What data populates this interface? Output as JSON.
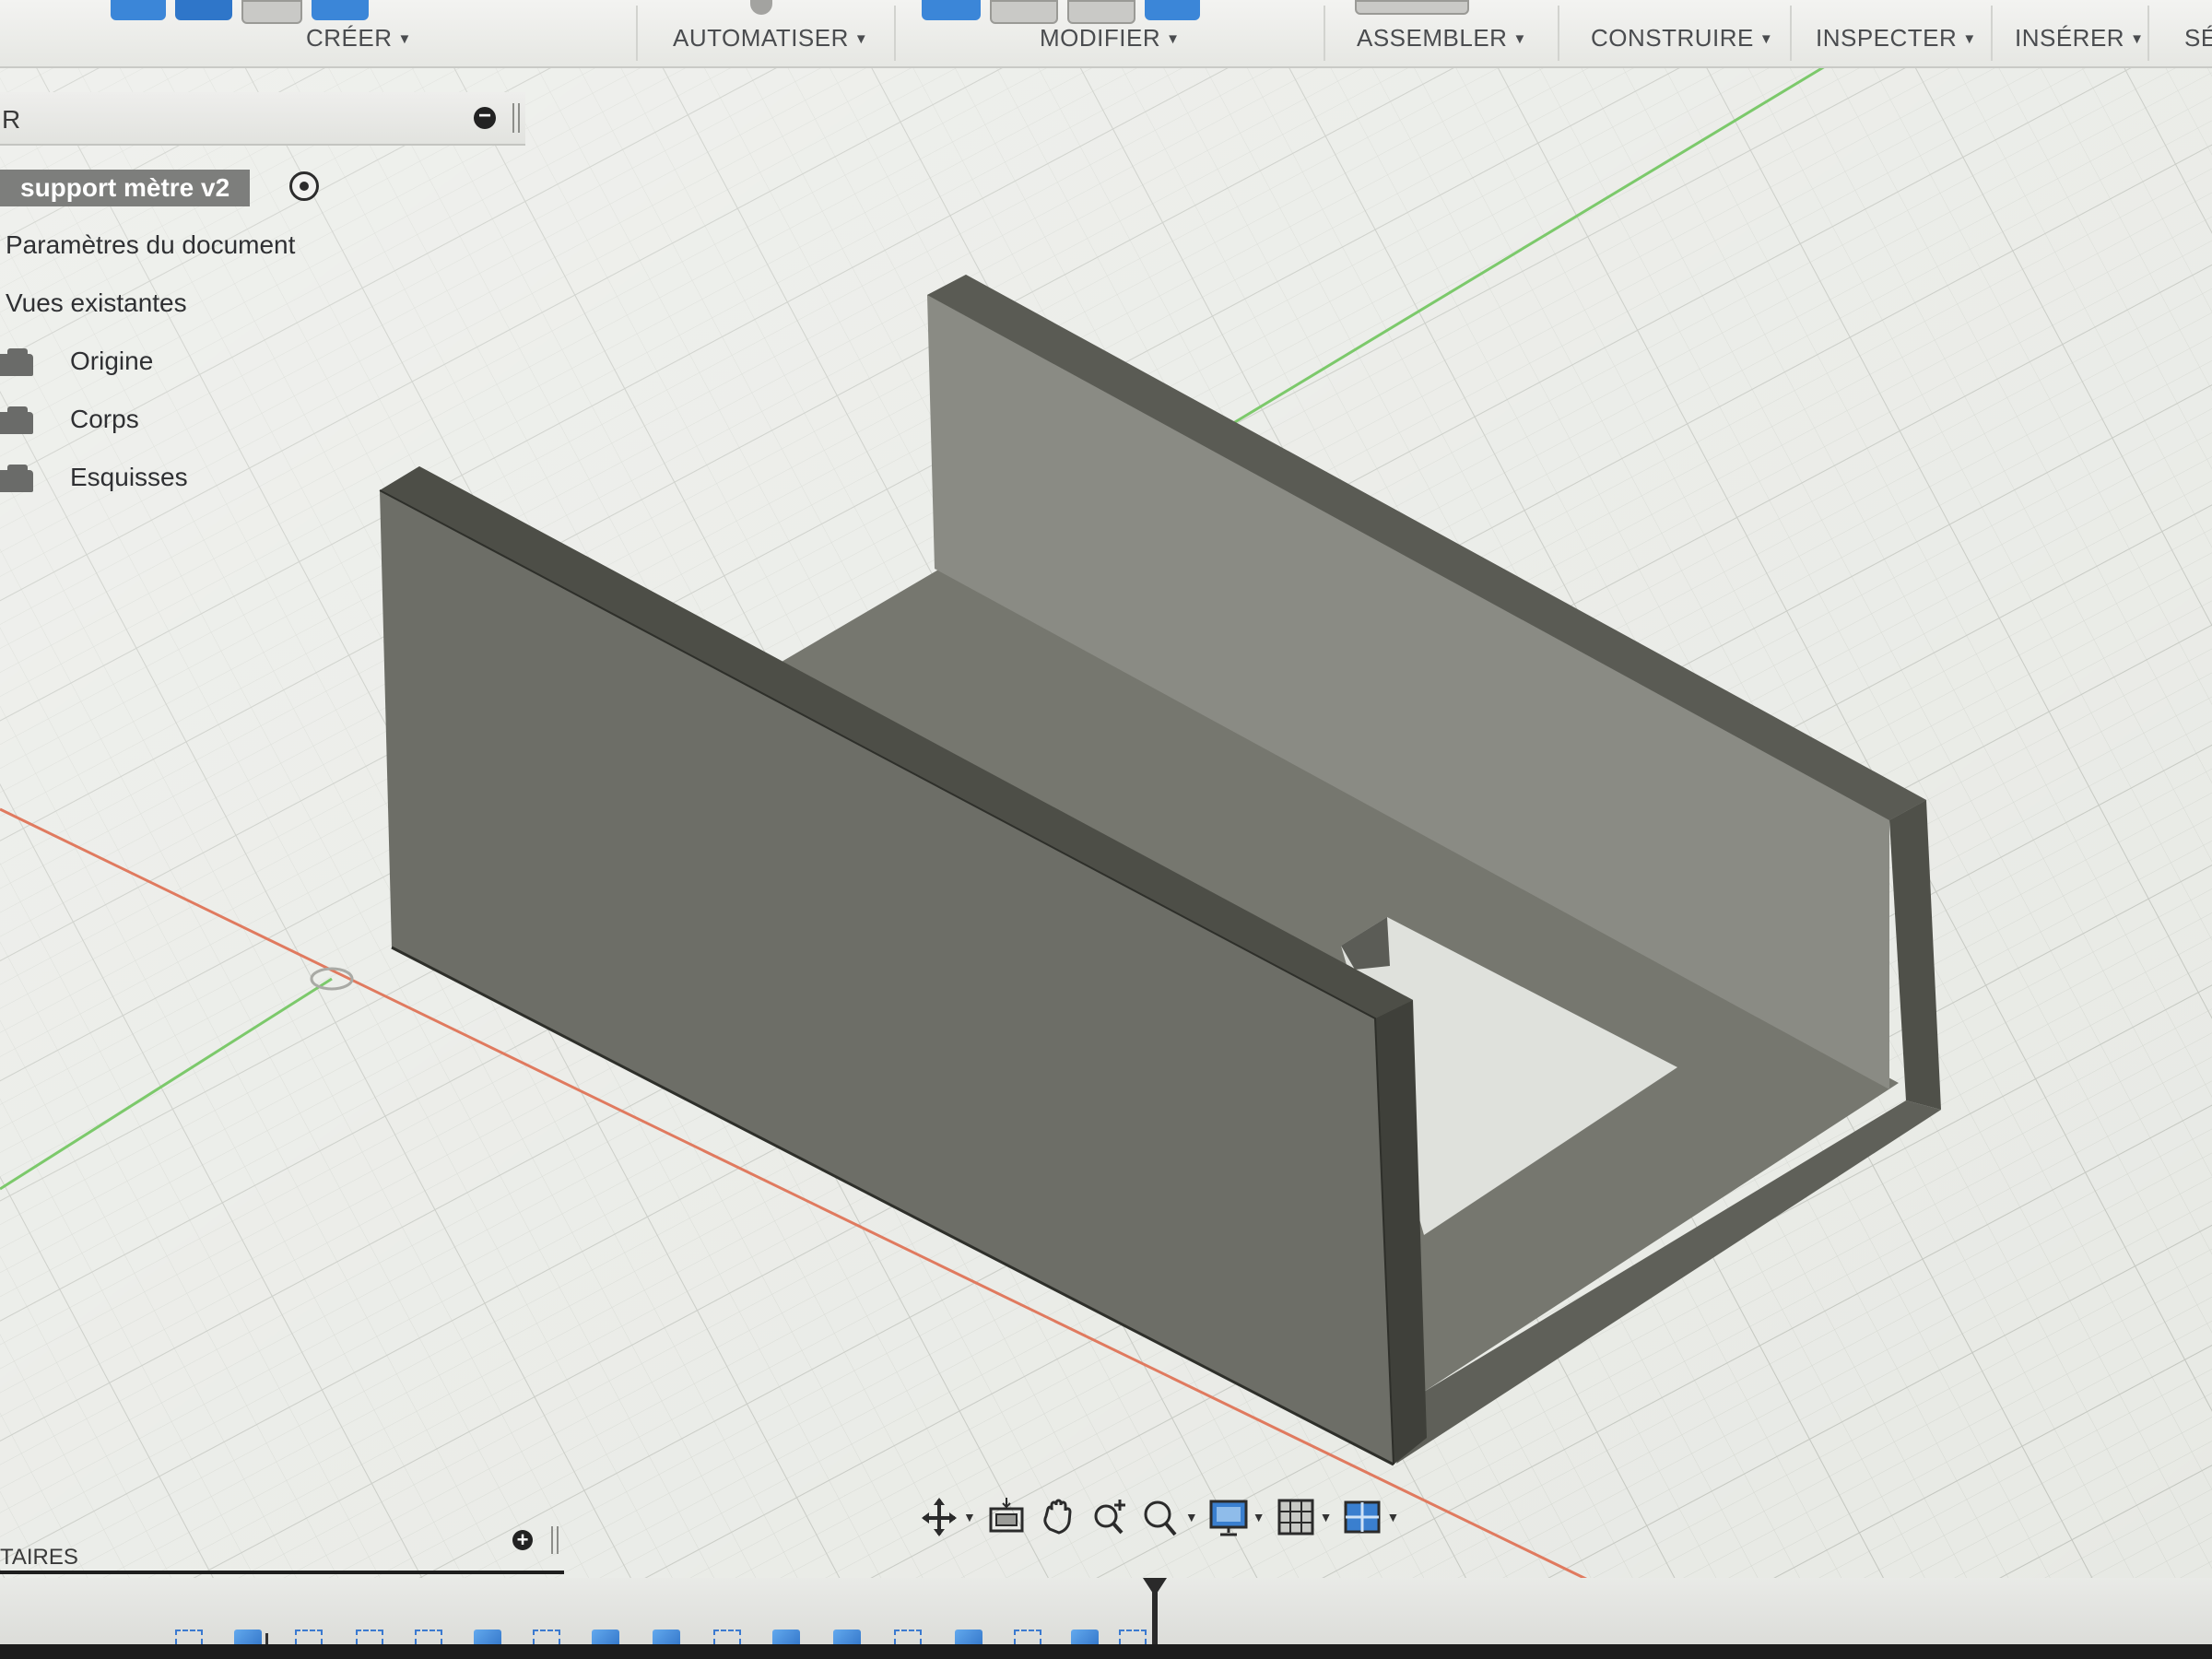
{
  "toolbar": {
    "menus": [
      {
        "label": "CRÉER",
        "caret": "▼"
      },
      {
        "label": "AUTOMATISER",
        "caret": "▼"
      },
      {
        "label": "MODIFIER",
        "caret": "▼"
      },
      {
        "label": "ASSEMBLER",
        "caret": "▼"
      },
      {
        "label": "CONSTRUIRE",
        "caret": "▼"
      },
      {
        "label": "INSPECTER",
        "caret": "▼"
      },
      {
        "label": "INSÉRER",
        "caret": "▼"
      },
      {
        "label": "SÉ"
      }
    ]
  },
  "browser": {
    "header_label": "R",
    "document_title": "support mètre v2",
    "items": [
      {
        "label": "Paramètres du document"
      },
      {
        "label": "Vues existantes"
      },
      {
        "label": "Origine",
        "icon": "folder-icon"
      },
      {
        "label": "Corps",
        "icon": "folder-icon"
      },
      {
        "label": "Esquisses",
        "icon": "folder-icon"
      }
    ]
  },
  "comments": {
    "label": "TAIRES",
    "add_symbol": "+"
  },
  "colors": {
    "grid_background": "#e7e9e4",
    "x_axis": "#e07a5f",
    "y_axis": "#7cc96b",
    "body_face": "#6f6f68",
    "accent_blue": "#2c6fc4"
  },
  "navbar": {
    "tools": [
      "orbit-icon",
      "look-at-icon",
      "pan-icon",
      "zoom-icon",
      "zoom-window-icon",
      "display-settings-icon",
      "grid-settings-icon",
      "viewports-icon"
    ]
  }
}
